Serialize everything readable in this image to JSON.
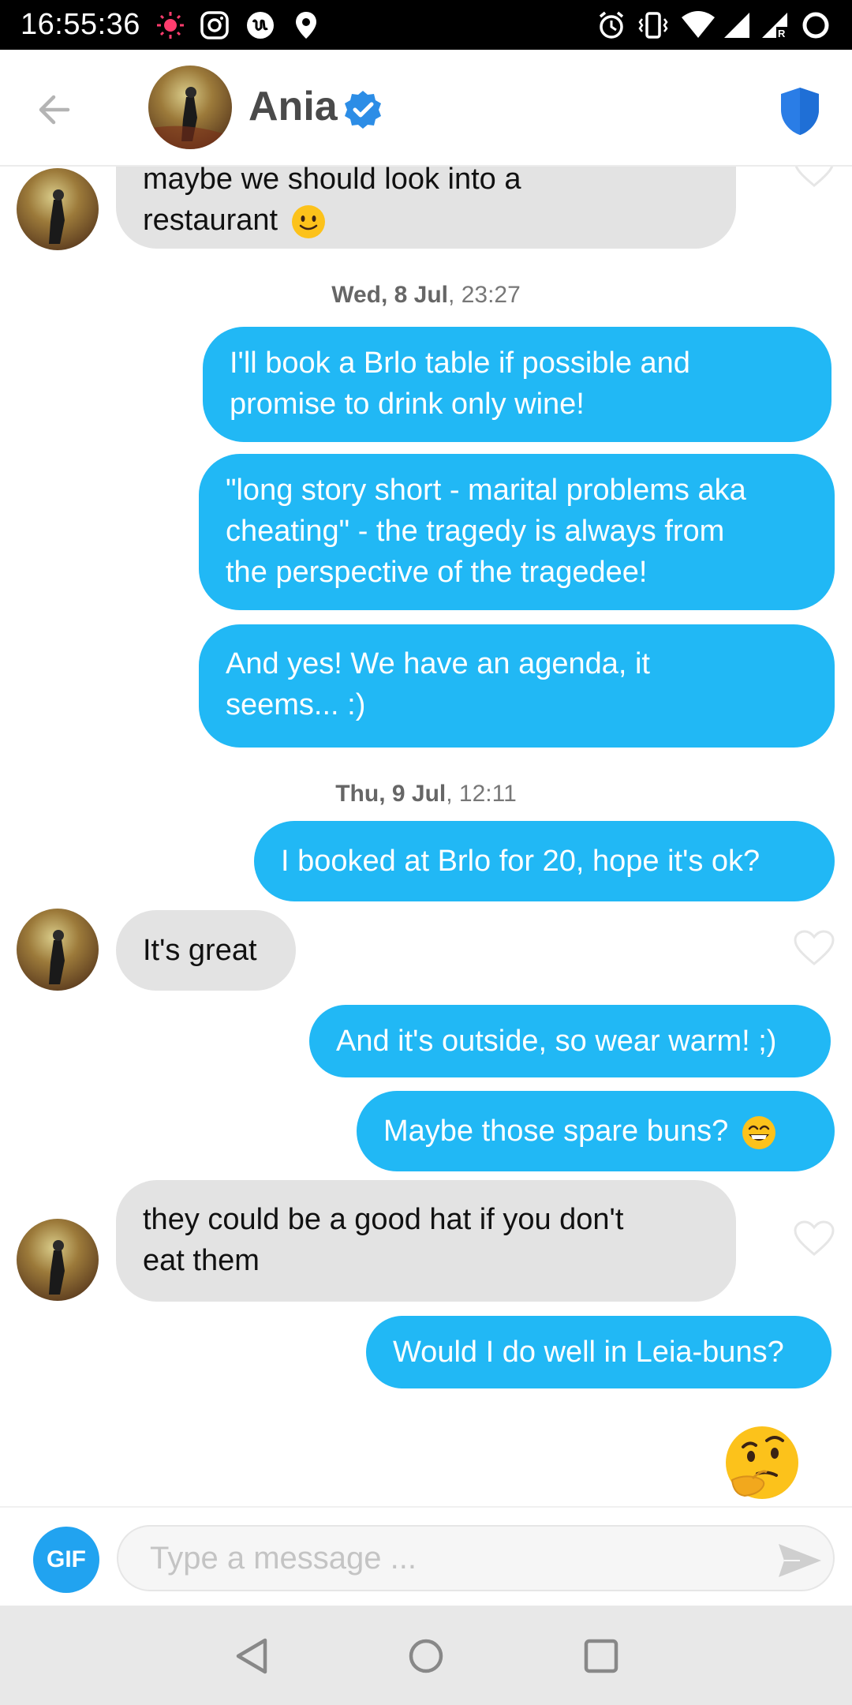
{
  "status_bar": {
    "time": "16:55:36",
    "left_icons": [
      "weather-sun-icon",
      "instagram-icon",
      "app-u-icon",
      "location-pin-icon"
    ],
    "right_icons": [
      "alarm-icon",
      "vibrate-icon",
      "wifi-icon",
      "signal-icon",
      "signal-roaming-icon",
      "battery-ring-icon"
    ]
  },
  "header": {
    "name": "Ania",
    "verified": true,
    "brand_color": "#21b8f5"
  },
  "messages": [
    {
      "from": "them",
      "text_partial_top": "maybe we should look into a",
      "text": "restaurant",
      "emoji": "slightly-smiling-face"
    },
    {
      "type": "date",
      "day": "Wed, 8 Jul",
      "time": ", 23:27"
    },
    {
      "from": "me",
      "lines": [
        "I'll book a Brlo table if possible and",
        "promise to drink only wine!"
      ]
    },
    {
      "from": "me",
      "lines": [
        "\"long story short - marital problems aka",
        "cheating\" - the tragedy is always from",
        "the perspective of the tragedee!"
      ]
    },
    {
      "from": "me",
      "lines": [
        "And yes! We have an agenda, it",
        "seems... :)"
      ]
    },
    {
      "type": "date",
      "day": "Thu, 9 Jul",
      "time": ", 12:11"
    },
    {
      "from": "me",
      "text": "I booked at Brlo for 20, hope it's ok?"
    },
    {
      "from": "them",
      "text": "It's great"
    },
    {
      "from": "me",
      "text": "And it's outside, so wear warm! ;)"
    },
    {
      "from": "me",
      "text": "Maybe those spare buns?",
      "emoji": "grinning-face-with-smiling-eyes"
    },
    {
      "from": "them",
      "lines": [
        "they could be a good hat if you don't",
        "eat them"
      ]
    },
    {
      "from": "me",
      "text": "Would I do well in Leia-buns?"
    },
    {
      "from": "me",
      "emoji_only": "thinking-face"
    }
  ],
  "composer": {
    "gif_label": "GIF",
    "placeholder": "Type a message ..."
  }
}
